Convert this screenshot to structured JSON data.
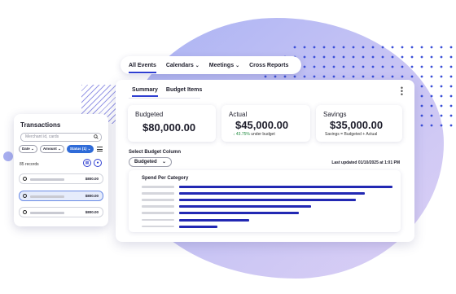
{
  "colors": {
    "accent": "#2f3fd1",
    "bar": "#2228b3",
    "positive": "#1f8a3e",
    "status_chip": "#2f6bd8",
    "blob": "#b7bdf4"
  },
  "nav": {
    "items": [
      {
        "label": "All Events",
        "active": true,
        "dropdown": false
      },
      {
        "label": "Calendars",
        "active": false,
        "dropdown": true
      },
      {
        "label": "Meetings",
        "active": false,
        "dropdown": true
      },
      {
        "label": "Cross Reports",
        "active": false,
        "dropdown": false
      }
    ]
  },
  "dashboard": {
    "tabs": [
      {
        "label": "Summary",
        "active": true
      },
      {
        "label": "Budget Items",
        "active": false
      }
    ],
    "menu_icon": "kebab-icon",
    "metrics": {
      "budgeted": {
        "label": "Budgeted",
        "value": "$80,000.00"
      },
      "actual": {
        "label": "Actual",
        "value": "$45,000.00",
        "trend_icon": "arrow-down-icon",
        "percent": "43.75%",
        "sub": "under budget"
      },
      "savings": {
        "label": "Savings",
        "value": "$35,000.00",
        "sub": "Savings = Budgeted + Actual"
      }
    },
    "select_label": "Select Budget Column",
    "select_value": "Budgeted",
    "last_updated": "Last updated 01/10/2025 at 1:01 PM",
    "spend": {
      "title": "Spend Per Category",
      "bar_fractions": [
        1.0,
        0.87,
        0.83,
        0.62,
        0.56,
        0.33,
        0.18
      ]
    }
  },
  "transactions": {
    "title": "Transactions",
    "search_placeholder": "Merchant id, cards",
    "filters": [
      {
        "label": "Date",
        "active": false
      },
      {
        "label": "Amount",
        "active": false
      },
      {
        "label": "Status (1)",
        "active": true
      }
    ],
    "records": "85 records",
    "rows": [
      {
        "amount": "$800.00",
        "selected": false
      },
      {
        "amount": "$800.00",
        "selected": true
      },
      {
        "amount": "$800.00",
        "selected": false
      }
    ]
  }
}
